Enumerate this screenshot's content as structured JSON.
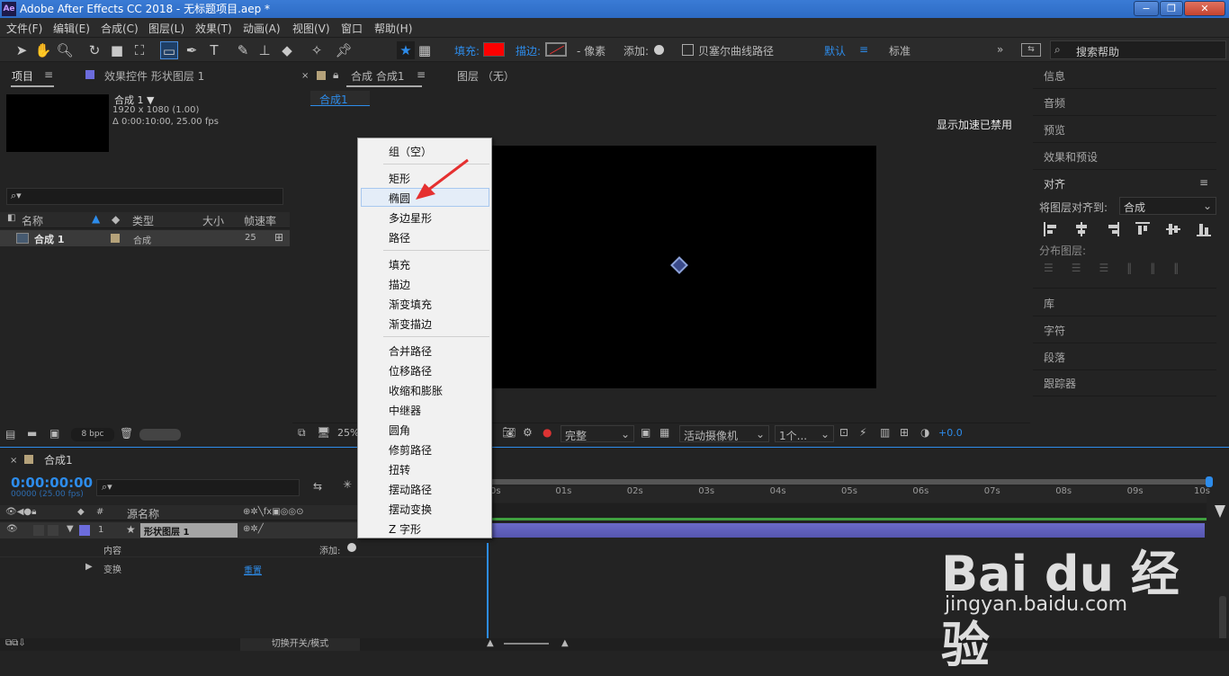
{
  "window": {
    "title": "Adobe After Effects CC 2018 - 无标题项目.aep *",
    "app_icon": "Ae",
    "minimize": "−",
    "maximize": "❐",
    "close": "✕"
  },
  "menu": [
    "文件(F)",
    "编辑(E)",
    "合成(C)",
    "图层(L)",
    "效果(T)",
    "动画(A)",
    "视图(V)",
    "窗口",
    "帮助(H)"
  ],
  "toolbar": {
    "fill_label": "填充:",
    "stroke_label": "描边:",
    "stroke_units": "- 像素",
    "add_label": "添加:",
    "bezier_label": "贝塞尔曲线路径",
    "workspace_default": "默认",
    "workspace_standard": "标准",
    "search_placeholder": "搜索帮助",
    "fill_color": "#ff0000"
  },
  "project_panel": {
    "tab_project": "项目",
    "tab_effects": "效果控件 形状图层 1",
    "comp_name": "合成 1 ▼",
    "comp_res": "1920 x 1080 (1.00)",
    "comp_dur": "Δ 0:00:10:00, 25.00 fps",
    "search_icon": "⌕▾",
    "col_name": "名称",
    "col_type": "类型",
    "col_size": "大小",
    "col_fps": "帧速率",
    "row_name": "合成 1",
    "row_type": "合成",
    "row_fps": "25",
    "bpc": "8 bpc"
  },
  "comp_panel": {
    "tab_comp": "合成 合成1",
    "tab_layer": "图层 （无）",
    "breadcrumb": "合成1",
    "accel_msg": "显示加速已禁用",
    "zoom": "25%",
    "quality": "完整",
    "camera": "活动摄像机",
    "views": "1个...",
    "exposure": "+0.0"
  },
  "context_menu": {
    "items": [
      "组（空）",
      "矩形",
      "椭圆",
      "多边星形",
      "路径",
      "填充",
      "描边",
      "渐变填充",
      "渐变描边",
      "合并路径",
      "位移路径",
      "收缩和膨胀",
      "中继器",
      "圆角",
      "修剪路径",
      "扭转",
      "摆动路径",
      "摆动变换",
      "Z 字形"
    ],
    "highlighted": "椭圆"
  },
  "right_panel": {
    "info": "信息",
    "audio": "音频",
    "preview": "预览",
    "effects_presets": "效果和预设",
    "align": "对齐",
    "align_to_label": "将图层对齐到:",
    "align_to_value": "合成",
    "distribute": "分布图层:",
    "library": "库",
    "character": "字符",
    "paragraph": "段落",
    "tracker": "跟踪器"
  },
  "timeline": {
    "tab": "合成1",
    "timecode": "0:00:00:00",
    "frames": "00000 (25.00 fps)",
    "col_num": "#",
    "col_source": "源名称",
    "layer_num": "1",
    "layer_name": "形状图层 1",
    "contents": "内容",
    "add": "添加:",
    "transform": "变换",
    "reset": "重置",
    "toggle_modes": "切换开关/模式",
    "ruler": [
      "0s",
      "01s",
      "02s",
      "03s",
      "04s",
      "05s",
      "06s",
      "07s",
      "08s",
      "09s",
      "10s"
    ]
  },
  "watermark": {
    "logo": "Bai du 经验",
    "url": "jingyan.baidu.com"
  }
}
